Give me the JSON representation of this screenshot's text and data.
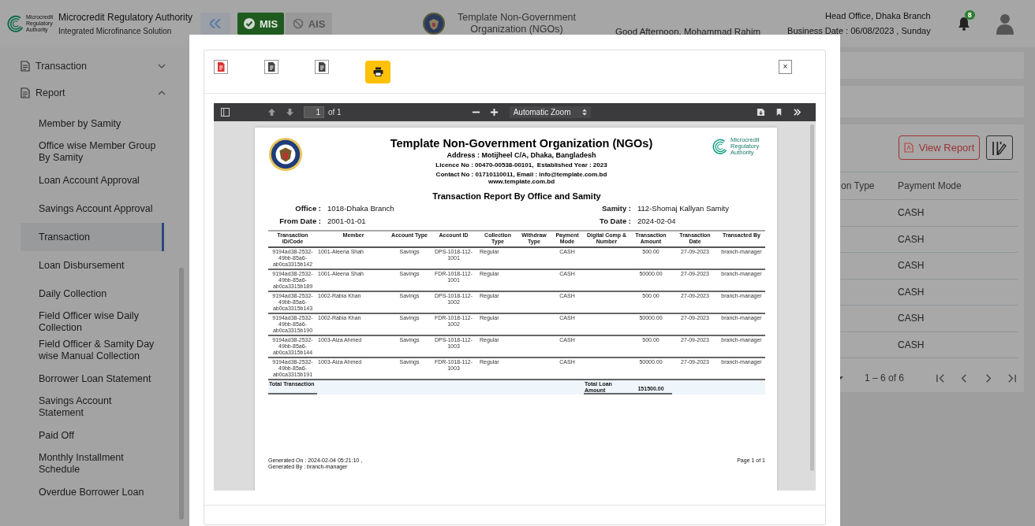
{
  "header": {
    "logo_text": "Microcredit Regulatory Authority",
    "org_title": "Microcredit Regulatory Authority",
    "org_subtitle": "Integrated Microfinance Solution",
    "modules": [
      {
        "label": "MIS",
        "selected": true
      },
      {
        "label": "AIS",
        "selected": false
      }
    ],
    "ngo_name": "Template Non-Government Organization (NGOs)",
    "greeting": "Good Afternoon, Mohammad Rahim",
    "branch": "Head Office, Dhaka Branch",
    "business_date": "Business Date : 06/08/2023 , Sunday",
    "notification_count": "8"
  },
  "sidebar": {
    "items": [
      {
        "label": "Transaction",
        "expanded": false
      },
      {
        "label": "Report",
        "expanded": true,
        "children": [
          {
            "label": "Member by Samity",
            "selected": false
          },
          {
            "label": "Office wise Member Group By Samity",
            "selected": false
          },
          {
            "label": "Loan Account Approval",
            "selected": false
          },
          {
            "label": "Savings Account Approval",
            "selected": false
          },
          {
            "label": "Transaction",
            "selected": true
          },
          {
            "label": "Loan Disbursement",
            "selected": false
          },
          {
            "label": "Daily Collection",
            "selected": false
          },
          {
            "label": "Field Officer wise Daily Collection",
            "selected": false
          },
          {
            "label": "Field Officer & Samity Day wise Manual Collection",
            "selected": false
          },
          {
            "label": "Borrower Loan Statement",
            "selected": false
          },
          {
            "label": "Savings Account Statement",
            "selected": false
          },
          {
            "label": "Paid Off",
            "selected": false
          },
          {
            "label": "Monthly Installment Schedule",
            "selected": false
          },
          {
            "label": "Overdue Borrower Loan",
            "selected": false
          }
        ]
      }
    ]
  },
  "background_page": {
    "view_report_button": "View Report",
    "columns": [
      "on Type",
      "Payment Mode"
    ],
    "rows": [
      {
        "payment_mode": "CASH"
      },
      {
        "payment_mode": "CASH"
      },
      {
        "payment_mode": "CASH"
      },
      {
        "payment_mode": "CASH"
      },
      {
        "payment_mode": "CASH"
      },
      {
        "payment_mode": "CASH"
      }
    ],
    "pagination": "1 – 6 of 6"
  },
  "modal": {
    "export_buttons": [
      {
        "kind": "pdf"
      },
      {
        "kind": "word"
      },
      {
        "kind": "excel"
      },
      {
        "kind": "print"
      }
    ],
    "close_label": "×",
    "pdf_viewer": {
      "page_number": "1",
      "page_count": "of 1",
      "zoom": "Automatic Zoom"
    },
    "report": {
      "logo_text": "Microcredit Regulatory Authority",
      "title": "Template Non-Government Organization (NGOs)",
      "address": "Address : Motijheel C/A, Dhaka, Bangladesh",
      "licence": "Licence No : 00470-00538-00101,  Established Year : 2023",
      "contact": "Contact No : 01710110011, Email : info@template.com.bd",
      "website": "www.template.com.bd",
      "subtitle": "Transaction Report By Office and Samity",
      "filters": [
        {
          "label": "Office :",
          "value": "1018-Dhaka Branch"
        },
        {
          "label": "Samity :",
          "value": "112-Shomaj Kallyan Samity"
        },
        {
          "label": "From Date :",
          "value": "2001-01-01"
        },
        {
          "label": "To Date :",
          "value": "2024-02-04"
        }
      ],
      "columns": [
        "Transaction ID/Code",
        "Member",
        "Account Type",
        "Account ID",
        "Collection Type",
        "Withdraw Type",
        "Payment Mode",
        "Digital Comp & Number",
        "Transaction Amount",
        "Transaction Date",
        "Transacted By"
      ],
      "rows": [
        [
          "9194ad38-2532-49bb-85a6-ab0ca3315b142",
          "1001-Aleena Shah",
          "Savings",
          "DPS-1018-112-1001",
          "Regular",
          "",
          "CASH",
          "",
          "500.00",
          "27-09-2023",
          "branch-manager"
        ],
        [
          "9194ad38-2532-49bb-85a6-ab0ca3315b189",
          "1001-Aleena Shah",
          "Savings",
          "FDR-1018-112-1001",
          "Regular",
          "",
          "CASH",
          "",
          "50000.00",
          "27-09-2023",
          "branch-manager"
        ],
        [
          "9194ad38-2532-49bb-85a6-ab0ca3315b143",
          "1002-Rabia Khan",
          "Savings",
          "DPS-1018-112-1002",
          "Regular",
          "",
          "CASH",
          "",
          "500.00",
          "27-09-2023",
          "branch-manager"
        ],
        [
          "9194ad38-2532-49bb-85a6-ab0ca3315b190",
          "1002-Rabia Khan",
          "Savings",
          "FDR-1018-112-1002",
          "Regular",
          "",
          "CASH",
          "",
          "50000.00",
          "27-09-2023",
          "branch-manager"
        ],
        [
          "9194ad38-2532-49bb-85a6-ab0ca3315b144",
          "1003-Aiza Ahmed",
          "Savings",
          "DPS-1018-112-1003",
          "Regular",
          "",
          "CASH",
          "",
          "500.00",
          "27-09-2023",
          "branch-manager"
        ],
        [
          "9194ad38-2532-49bb-85a6-ab0ca3315b191",
          "1003-Aiza Ahmed",
          "Savings",
          "FDR-1018-112-1003",
          "Regular",
          "",
          "CASH",
          "",
          "50000.00",
          "27-09-2023",
          "branch-manager"
        ]
      ],
      "total_row": {
        "label": "Total Transaction",
        "amount_label": "Total Loan Amount",
        "amount": "151500.00"
      },
      "generated_on": "Generated On : 2024-02-04 05:21:10 ,",
      "generated_by": "Generated By : branch-manager",
      "page": "Page 1 of 1"
    }
  }
}
